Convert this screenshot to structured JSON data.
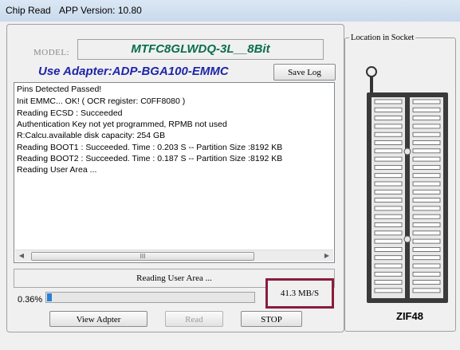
{
  "window": {
    "title": "Chip Read",
    "app_version": "APP Version: 10.80"
  },
  "model": {
    "label": "MODEL:",
    "value": "MTFC8GLWDQ-3L__8Bit"
  },
  "adapter": "Use Adapter:ADP-BGA100-EMMC",
  "buttons": {
    "save_log": "Save Log",
    "view_adapter": "View Adpter",
    "read": "Read",
    "stop": "STOP"
  },
  "log_lines": [
    "Pins Detected Passed!",
    "Init EMMC... OK!    ( OCR register: C0FF8080 )",
    "Reading ECSD : Succeeded",
    "      Authentication Key not yet programmed, RPMB not used",
    "R:Calcu.available disk capacity: 254 GB",
    "Reading BOOT1 : Succeeded. Time : 0.203 S -- Partition Size :8192 KB",
    "Reading BOOT2 : Succeeded. Time : 0.187 S -- Partition Size :8192 KB",
    "Reading User Area ..."
  ],
  "scrollbar_thumb_glyph": "III",
  "status_text": "Reading User Area ...",
  "progress": {
    "percent_label": "0.36%",
    "fraction": 0.0036
  },
  "speed": "41.3 MB/S",
  "socket": {
    "title": "Location in Socket",
    "label": "ZIF48"
  },
  "colors": {
    "model_text": "#0a6e4a",
    "adapter_text": "#1e26a8",
    "highlight_border": "#8a1c3c",
    "progress_fill": "#2c7fd6"
  }
}
